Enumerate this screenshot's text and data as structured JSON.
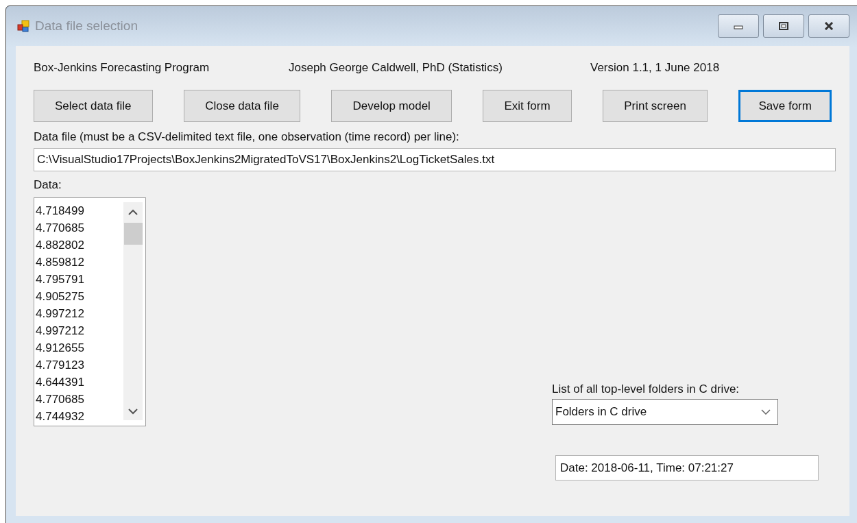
{
  "window": {
    "title": "Data file selection"
  },
  "header": [
    "Box-Jenkins Forecasting Program",
    "Joseph George Caldwell, PhD (Statistics)",
    "Version 1.1, 1 June 2018"
  ],
  "buttons": [
    {
      "label": "Select data file",
      "focused": false
    },
    {
      "label": "Close data file",
      "focused": false
    },
    {
      "label": "Develop model",
      "focused": false
    },
    {
      "label": "Exit form",
      "focused": false
    },
    {
      "label": "Print screen",
      "focused": false
    },
    {
      "label": "Save form",
      "focused": true
    }
  ],
  "data_file": {
    "label": "Data file (must be a CSV-delimited text file, one observation (time record) per line):",
    "value": "C:\\VisualStudio17Projects\\BoxJenkins2MigratedToVS17\\BoxJenkins2\\LogTicketSales.txt"
  },
  "data_list": {
    "label": "Data:",
    "items": [
      "4.718499",
      "4.770685",
      "4.882802",
      "4.859812",
      "4.795791",
      "4.905275",
      "4.997212",
      "4.997212",
      "4.912655",
      "4.779123",
      "4.644391",
      "4.770685",
      "4.744932"
    ]
  },
  "folders": {
    "label": "List of all top-level folders in C drive:",
    "value": "Folders in C drive"
  },
  "datetime": {
    "value": "Date: 2018-06-11, Time: 07:21:27"
  }
}
